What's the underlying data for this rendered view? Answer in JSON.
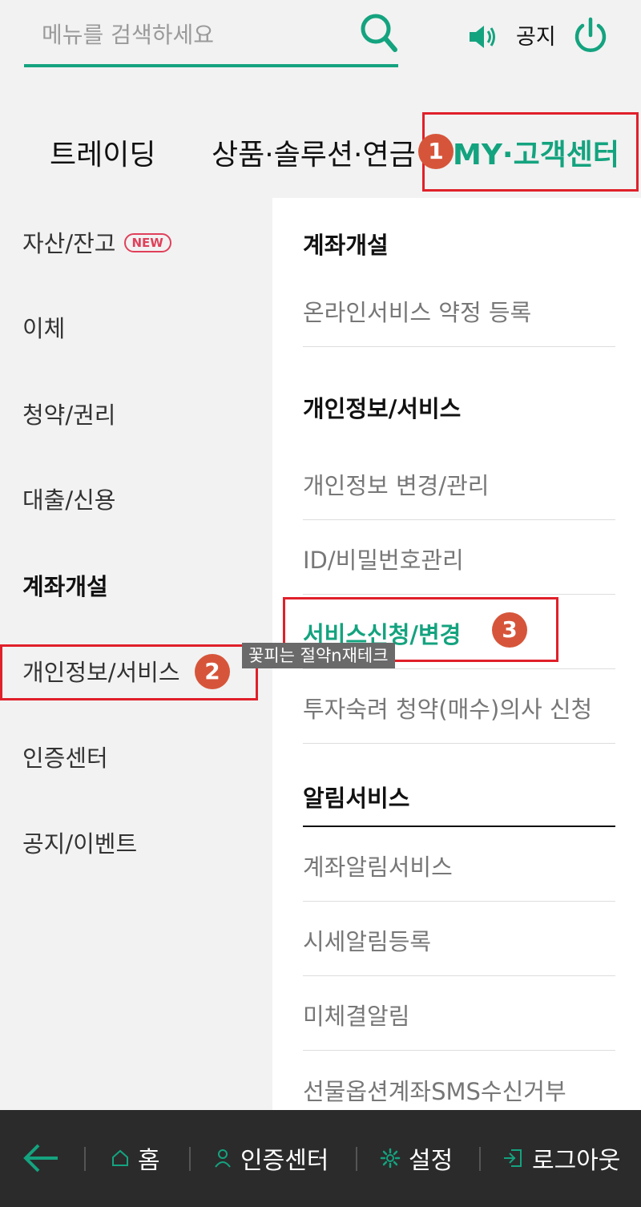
{
  "header": {
    "search_placeholder": "메뉴를 검색하세요",
    "notice_label": "공지"
  },
  "tabs": [
    {
      "label": "트레이딩"
    },
    {
      "label": "상품·솔루션·연금"
    },
    {
      "label": "MY·고객센터"
    }
  ],
  "left_nav": {
    "items": [
      {
        "label": "자산/잔고",
        "badge": "NEW"
      },
      {
        "label": "이체"
      },
      {
        "label": "청약/권리"
      },
      {
        "label": "대출/신용"
      },
      {
        "label": "계좌개설"
      },
      {
        "label": "개인정보/서비스"
      },
      {
        "label": "인증센터"
      },
      {
        "label": "공지/이벤트"
      }
    ]
  },
  "right_panel": {
    "sections": [
      {
        "title": "계좌개설",
        "items": [
          "온라인서비스 약정 등록"
        ]
      },
      {
        "title": "개인정보/서비스",
        "items": [
          "개인정보 변경/관리",
          "ID/비밀번호관리",
          "서비스신청/변경",
          "투자숙려 청약(매수)의사 신청"
        ]
      },
      {
        "title": "알림서비스",
        "items": [
          "계좌알림서비스",
          "시세알림등록",
          "미체결알림",
          "선물옵션계좌SMS수신거부"
        ]
      }
    ]
  },
  "tooltip": "꽃피는 절약n재테크",
  "annotations": {
    "step1": "1",
    "step2": "2",
    "step3": "3"
  },
  "bottom_bar": {
    "home": "홈",
    "auth": "인증센터",
    "settings": "설정",
    "logout": "로그아웃"
  },
  "colors": {
    "accent": "#14a37f",
    "highlight": "#e0202a",
    "badge": "#d6553a",
    "bottom_bar": "#2b2b2b"
  }
}
